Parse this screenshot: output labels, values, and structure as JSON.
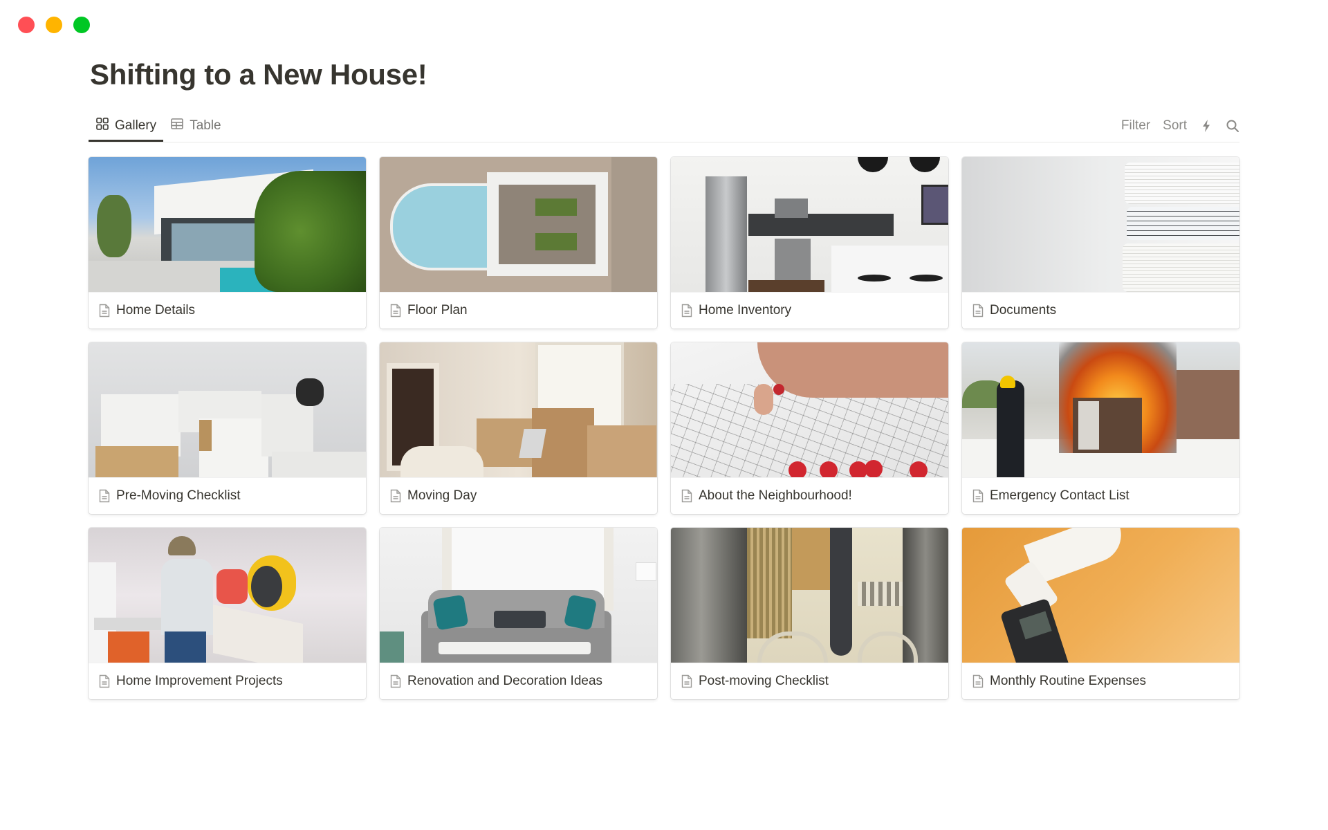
{
  "window": {
    "controls": [
      "close",
      "minimize",
      "maximize"
    ]
  },
  "page": {
    "title": "Shifting to a New House!"
  },
  "views": {
    "tabs": [
      {
        "label": "Gallery",
        "icon": "gallery-grid-icon",
        "active": true
      },
      {
        "label": "Table",
        "icon": "table-icon",
        "active": false
      }
    ],
    "tools": {
      "filter_label": "Filter",
      "sort_label": "Sort",
      "automation_icon": "lightning-bolt-icon",
      "search_icon": "search-icon"
    }
  },
  "gallery": {
    "cards": [
      {
        "title": "Home Details",
        "icon": "page-icon",
        "cover": "modern white villa with pool and plants"
      },
      {
        "title": "Floor Plan",
        "icon": "page-icon",
        "cover": "aerial view of building rooftop"
      },
      {
        "title": "Home Inventory",
        "icon": "page-icon",
        "cover": "white kitchen with steel appliances"
      },
      {
        "title": "Documents",
        "icon": "page-icon",
        "cover": "stack of binders"
      },
      {
        "title": "Pre-Moving Checklist",
        "icon": "page-icon",
        "cover": "packed cardboard boxes"
      },
      {
        "title": "Moving Day",
        "icon": "page-icon",
        "cover": "living room with moving boxes"
      },
      {
        "title": "About the Neighbourhood!",
        "icon": "page-icon",
        "cover": "hand placing red pin on map"
      },
      {
        "title": "Emergency Contact List",
        "icon": "page-icon",
        "cover": "firefighter and burning shed"
      },
      {
        "title": "Home Improvement Projects",
        "icon": "page-icon",
        "cover": "men using miter saw"
      },
      {
        "title": "Renovation and Decoration Ideas",
        "icon": "page-icon",
        "cover": "grey tufted sofa with teal pillows"
      },
      {
        "title": "Post-moving Checklist",
        "icon": "page-icon",
        "cover": "church interior painting with organ"
      },
      {
        "title": "Monthly Routine Expenses",
        "icon": "page-icon",
        "cover": "card machine printing receipt on orange"
      }
    ]
  },
  "colors": {
    "text": "#37352F",
    "muted": "#787774",
    "divider": "#E9E9E7",
    "traffic_red": "#FF4F55",
    "traffic_yellow": "#FFB400",
    "traffic_green": "#00C724"
  }
}
